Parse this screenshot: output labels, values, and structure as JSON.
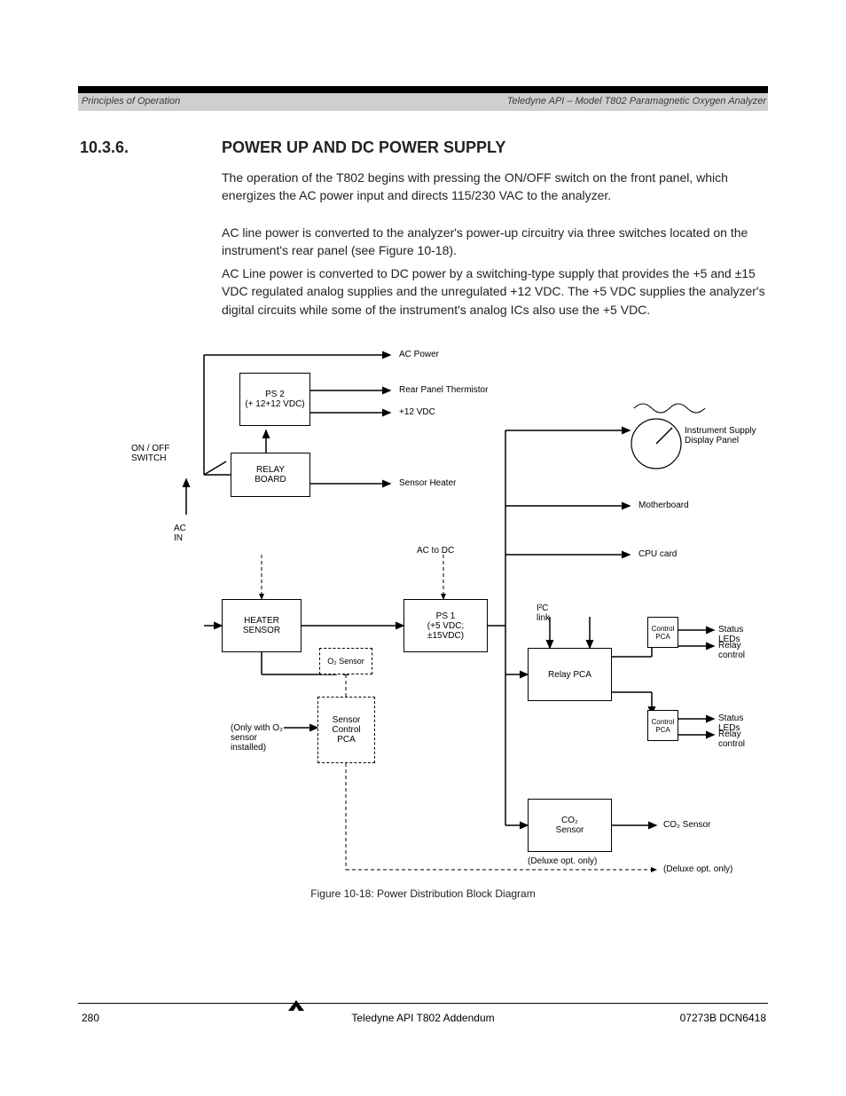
{
  "header": {
    "left": "Principles of Operation",
    "right": "Teledyne API – Model T802 Paramagnetic Oxygen Analyzer"
  },
  "section": {
    "number": "10.3.6.",
    "title": "POWER UP AND DC POWER SUPPLY",
    "p1": "The operation of the T802 begins with pressing the ON/OFF switch on the front panel, which energizes the AC power input and directs 115/230 VAC to the analyzer.",
    "p2": "AC line power is converted to the analyzer's power-up circuitry via three switches located on the instrument's rear panel (see Figure 10-18).",
    "p3": "AC Line power is converted to DC power by a switching-type supply that provides the +5 and ±15 VDC regulated analog supplies and the unregulated +12 VDC. The +5 VDC supplies the analyzer's digital circuits while some of the instrument's analog ICs also use the +5 VDC."
  },
  "diagram": {
    "ac_in": "AC\nIN",
    "on_off": "ON / OFF\nSWITCH",
    "relay_board": "RELAY\nBOARD",
    "ps2": "PS 2\n(+ 12+12 VDC)",
    "ps2_out_top": "Rear Panel Thermistor",
    "ps2_out_mid": "+12 VDC",
    "ac_out": "AC Power",
    "heater": "HEATER\nSENSOR",
    "heater_out": "Sensor Heater",
    "ps1": "PS 1\n(+5 VDC;\n±15VDC)",
    "ac_to_dc": "AC to DC",
    "sensor_ctrl": "Sensor\nControl\nPCA",
    "o2_sensor": "O₂\nSensor",
    "o2_inline": "(Only with O₂\nsensor installed)",
    "meter_lbl": "Instrument Supply\nDisplay Panel",
    "mother": "Motherboard",
    "cpu": "CPU card",
    "relay_pca": "Relay PCA",
    "i2c": "I²C\nlink",
    "i2c_status": "Status LEDs",
    "i2c_valve": "Relay control",
    "i2c_ctrl": "Control\nPCA",
    "i2c_co2": "Status LEDs",
    "i2c_co2v": "Relay control",
    "co2_sensor": "CO₂\nSensor",
    "co2_out": "CO₂ Sensor",
    "co2_inline": "(Deluxe opt. only)",
    "dashed_out": "(Deluxe opt. only)"
  },
  "figure_caption": "Figure 10-18:  Power Distribution Block Diagram",
  "footer": {
    "left": "280",
    "center": "Teledyne API T802 Addendum",
    "right": "07273B DCN6418"
  }
}
